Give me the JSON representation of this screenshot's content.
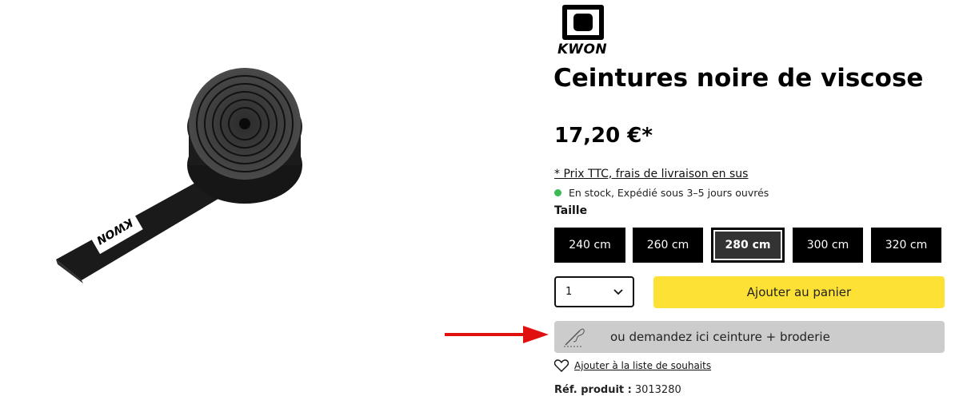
{
  "brand": {
    "logo_text": "KWON"
  },
  "product": {
    "title": "Ceintures noire de viscose",
    "price": "17,20 €*",
    "tax_note": "* Prix TTC, frais de livraison en sus",
    "stock": "En stock, Expédié sous 3–5 jours ouvrés",
    "image_label": "KWON"
  },
  "size": {
    "label": "Taille",
    "options": [
      "240 cm",
      "260 cm",
      "280 cm",
      "300 cm",
      "320 cm"
    ],
    "selected": "280 cm"
  },
  "purchase": {
    "quantity": "1",
    "add_to_cart": "Ajouter au panier",
    "embroidery": "ou demandez ici ceinture + broderie"
  },
  "wishlist": {
    "label": "Ajouter à la liste de souhaits"
  },
  "reference": {
    "label": "Réf. produit :",
    "value": "3013280"
  },
  "colors": {
    "cart": "#fde235",
    "stock": "#3cba54",
    "arrow": "#e01010"
  }
}
